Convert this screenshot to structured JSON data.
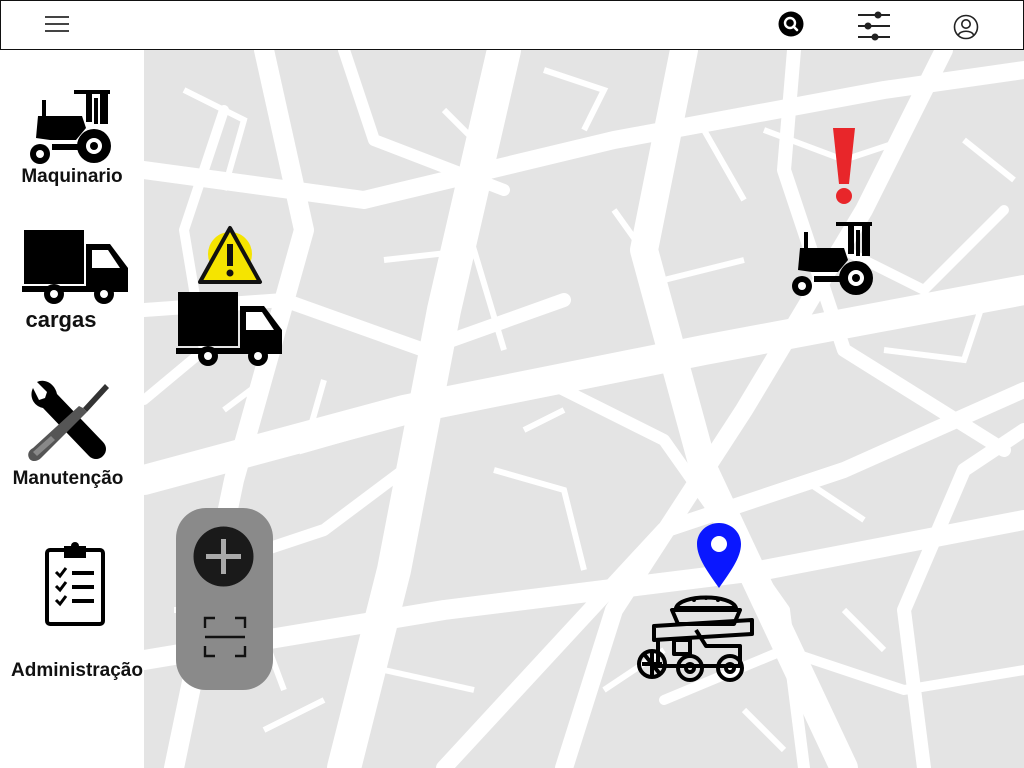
{
  "header": {
    "menu_icon": "hamburger-menu-icon",
    "search_icon": "search-icon",
    "filter_icon": "sliders-icon",
    "profile_icon": "user-profile-icon"
  },
  "sidebar": {
    "items": [
      {
        "label": "Maquinario",
        "icon": "tractor-icon"
      },
      {
        "label": "cargas",
        "icon": "truck-icon"
      },
      {
        "label": "Manutenção",
        "icon": "wrench-screwdriver-icon"
      },
      {
        "label": "Administração",
        "icon": "clipboard-checklist-icon"
      }
    ]
  },
  "map": {
    "markers": [
      {
        "type": "truck",
        "status": "warning",
        "icon": "warning-triangle-icon",
        "status_color": "#f5e400"
      },
      {
        "type": "tractor",
        "status": "alert",
        "icon": "exclamation-icon",
        "status_color": "#e8262a"
      },
      {
        "type": "harvester",
        "status": "located",
        "icon": "location-pin-icon",
        "status_color": "#0a17ff"
      }
    ],
    "controls": {
      "zoom_in_icon": "plus-icon",
      "fullscreen_icon": "fullscreen-icon"
    }
  },
  "colors": {
    "map_background": "#e4e4e4",
    "roads": "#ffffff",
    "control_panel": "#8a8a8a"
  }
}
